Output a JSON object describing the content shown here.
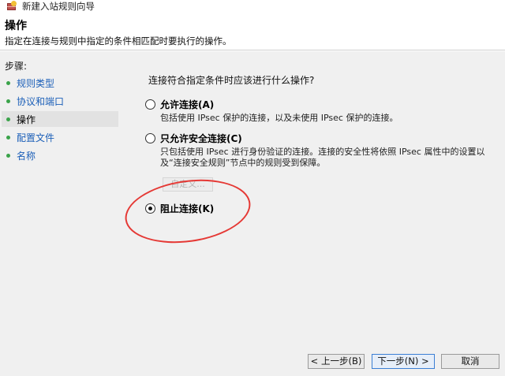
{
  "window": {
    "title": "新建入站规则向导"
  },
  "header": {
    "title": "操作",
    "description": "指定在连接与规则中指定的条件相匹配时要执行的操作。"
  },
  "steps": {
    "label": "步骤:",
    "items": [
      {
        "label": "规则类型",
        "current": false
      },
      {
        "label": "协议和端口",
        "current": false
      },
      {
        "label": "操作",
        "current": true
      },
      {
        "label": "配置文件",
        "current": false
      },
      {
        "label": "名称",
        "current": false
      }
    ]
  },
  "main": {
    "question": "连接符合指定条件时应该进行什么操作?",
    "options": [
      {
        "label": "允许连接(A)",
        "description": "包括使用 IPsec 保护的连接，以及未使用 IPsec 保护的连接。",
        "checked": false
      },
      {
        "label": "只允许安全连接(C)",
        "description": "只包括使用 IPsec 进行身份验证的连接。连接的安全性将依照 IPsec 属性中的设置以及“连接安全规则”节点中的规则受到保障。",
        "checked": false
      },
      {
        "label": "阻止连接(K)",
        "description": "",
        "checked": true
      }
    ],
    "customize_label": "自定义..."
  },
  "footer": {
    "back_label": "< 上一步(B)",
    "next_label": "下一步(N) >",
    "cancel_label": "取消"
  },
  "colors": {
    "annotation": "#e53935",
    "step_dot": "#3aa34a",
    "link": "#1b5fb8"
  }
}
